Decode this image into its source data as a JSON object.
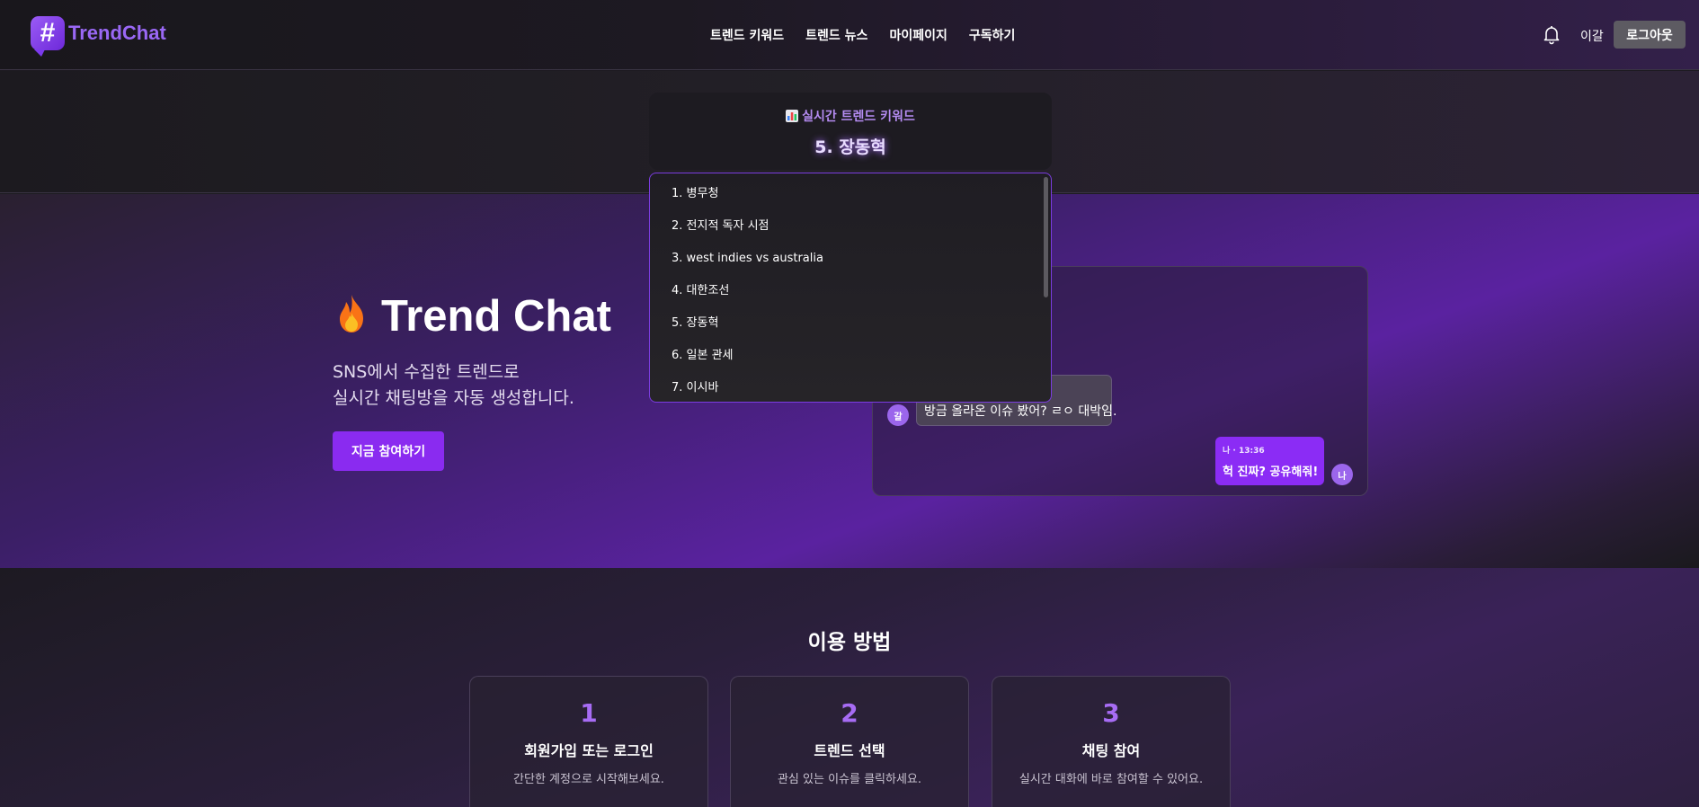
{
  "header": {
    "logo_mark": "#",
    "logo_text": "TrendChat",
    "nav": [
      "트렌드 키워드",
      "트렌드 뉴스",
      "마이페이지",
      "구독하기"
    ],
    "username": "이갈",
    "logout_label": "로그아웃"
  },
  "trending": {
    "title": "실시간 트렌드 키워드",
    "current": "5. 장동혁",
    "items": [
      "1. 병무청",
      "2. 전지적 독자 시점",
      "3. west indies vs australia",
      "4. 대한조선",
      "5. 장동혁",
      "6. 일본 관세",
      "7. 이시바"
    ]
  },
  "hero": {
    "title": "Trend Chat",
    "subtitle_line1": "SNS에서 수집한 트렌드로",
    "subtitle_line2": "실시간 채팅방을 자동 생성합니다.",
    "join_label": "지금 참여하기"
  },
  "chat": {
    "left_avatar": "갈",
    "left_text": "방금 올라온 이슈 봤어? ㄹㅇ 대박임.",
    "right_meta": "나 · 13:36",
    "right_text": "헉 진짜? 공유해줘!",
    "right_avatar": "나"
  },
  "howto": {
    "title": "이용 방법",
    "steps": [
      {
        "num": "1",
        "title": "회원가입 또는 로그인",
        "desc": "간단한 계정으로 시작해보세요."
      },
      {
        "num": "2",
        "title": "트렌드 선택",
        "desc": "관심 있는 이슈를 클릭하세요."
      },
      {
        "num": "3",
        "title": "채팅 참여",
        "desc": "실시간 대화에 바로 참여할 수 있어요."
      }
    ]
  },
  "colors": {
    "accent": "#8a2bf0",
    "accent_text": "#a76cf4",
    "logo": "#9a68f5"
  }
}
